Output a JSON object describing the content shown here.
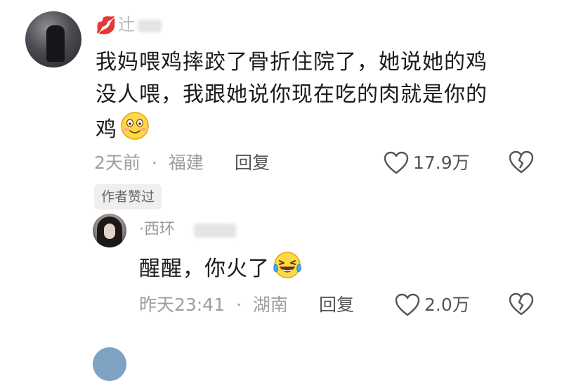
{
  "comment": {
    "username": "辻",
    "text_lines": [
      "我妈喂鸡摔跤了骨折住院了，她说她的鸡",
      "没人喂，我跟她说你现在吃的肉就是你的",
      "鸡"
    ],
    "emoji": "smiling-face-emoji",
    "time": "2天前",
    "separator": "·",
    "location": "福建",
    "reply_label": "回复",
    "like_count": "17.9万",
    "author_liked_badge": "作者赞过"
  },
  "reply": {
    "username": "·西环",
    "text": "醒醒，你火了",
    "emoji": "laughing-tears-emoji",
    "time": "昨天23:41",
    "separator": "·",
    "location": "湖南",
    "reply_label": "回复",
    "like_count": "2.0万"
  },
  "colors": {
    "text": "#1b1b1b",
    "meta": "#9e9e9e",
    "badge_bg": "#efefef",
    "lips_icon": "#e8607a"
  }
}
